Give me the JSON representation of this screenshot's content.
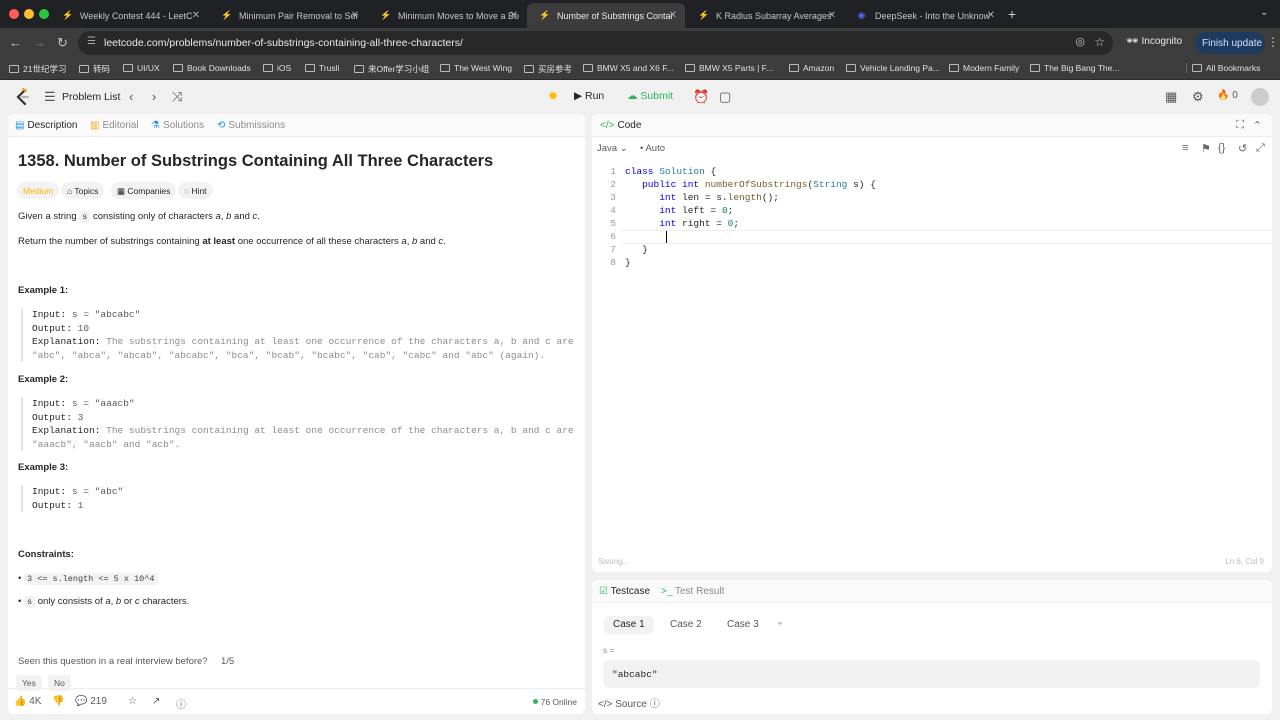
{
  "browser": {
    "tabs": [
      {
        "title": "Weekly Contest 444 - LeetC"
      },
      {
        "title": "Minimum Pair Removal to Sor"
      },
      {
        "title": "Minimum Moves to Move a Bo"
      },
      {
        "title": "Number of Substrings Contai"
      },
      {
        "title": "K Radius Subarray Averages"
      },
      {
        "title": "DeepSeek - Into the Unknow"
      }
    ],
    "url": "leetcode.com/problems/number-of-substrings-containing-all-three-characters/",
    "incognito_label": "Incognito",
    "finish_update_label": "Finish update",
    "bookmarks": [
      "21世纪学习",
      "转码",
      "UI/UX",
      "Book Downloads",
      "iOS",
      "Trusli",
      "来Offer学习小组",
      "The West Wing",
      "买房参考",
      "BMW X5 and X6 F...",
      "BMW X5 Parts | F...",
      "Amazon",
      "Vehicle Landing Pa...",
      "Modern Family",
      "The Big Bang The...",
      "All Bookmarks"
    ]
  },
  "header": {
    "problem_list_label": "Problem List",
    "run_label": "Run",
    "submit_label": "Submit",
    "streak_count": "0"
  },
  "left_panel": {
    "tabs": [
      "Description",
      "Editorial",
      "Solutions",
      "Submissions"
    ],
    "title": "1358. Number of Substrings Containing All Three Characters",
    "chips": [
      "Medium",
      "Topics",
      "Companies",
      "Hint"
    ],
    "desc1_pre": "Given a string",
    "desc1_code": "s",
    "desc1_mid": "consisting only of characters",
    "desc1_a": "a",
    "desc1_comma": ",",
    "desc1_b": "b",
    "desc1_and": "and",
    "desc1_c": "c",
    "desc1_end": ".",
    "desc2_pre": "Return the number of substrings containing",
    "desc2_bold": "at least",
    "desc2_mid": "one occurrence of all these characters",
    "desc2_a": "a",
    "desc2_comma": ",",
    "desc2_b": "b",
    "desc2_and": "and",
    "desc2_c": "c",
    "desc2_end": ".",
    "examples": [
      {
        "heading": "Example 1:",
        "input": "s = \"abcabc\"",
        "output": "10",
        "expl_line1": "The substrings containing at least one occurrence of the characters a, b and c are",
        "expl_line2": "\"abc\", \"abca\", \"abcab\", \"abcabc\", \"bca\", \"bcab\", \"bcabc\", \"cab\", \"cabc\" and \"abc\" (again)."
      },
      {
        "heading": "Example 2:",
        "input": "s = \"aaacb\"",
        "output": "3",
        "expl_line1": "The substrings containing at least one occurrence of the characters a, b and c are",
        "expl_line2": "\"aaacb\", \"aacb\" and \"acb\"."
      },
      {
        "heading": "Example 3:",
        "input": "s = \"abc\"",
        "output": "1"
      }
    ],
    "labels": {
      "input": "Input:",
      "output": "Output:",
      "explanation": "Explanation:"
    },
    "constraints_heading": "Constraints:",
    "constraint1_code": "3 <= s.length <= 5 x 10^4",
    "constraint2_code": "s",
    "constraint2_pre": "only consists of",
    "constraint2_a": "a",
    "constraint2_comma": ",",
    "constraint2_b": "b",
    "constraint2_or": "or",
    "constraint2_c": "c",
    "constraint2_end": "characters.",
    "seen_question": "Seen this question in a real interview before?",
    "seen_count": "1/5",
    "yes_label": "Yes",
    "no_label": "No",
    "likes": "4K",
    "comments": "219",
    "online": "76 Online"
  },
  "code_panel": {
    "label": "Code",
    "language": "Java",
    "mode": "Auto",
    "line_numbers": [
      "1",
      "2",
      "3",
      "4",
      "5",
      "6",
      "7",
      "8"
    ],
    "saving": "Saving...",
    "position": "Ln 6, Col 9"
  },
  "test_panel": {
    "testcase_label": "Testcase",
    "result_label": "Test Result",
    "cases": [
      "Case 1",
      "Case 2",
      "Case 3"
    ],
    "add_case": "+",
    "param_label": "s =",
    "param_value": "\"abcabc\"",
    "source_label": "Source"
  },
  "colors": {
    "accent_green": "#2db55d",
    "medium_yellow": "#ffb700",
    "leetcode_orange": "#ffa116"
  },
  "icons": [
    "leetcode-logo-icon",
    "list-icon",
    "chevron-left-icon",
    "chevron-right-icon",
    "shuffle-icon",
    "debug-icon",
    "play-icon",
    "upload-icon",
    "alarm-icon",
    "note-icon",
    "layout-icon",
    "gear-icon",
    "flame-icon"
  ]
}
